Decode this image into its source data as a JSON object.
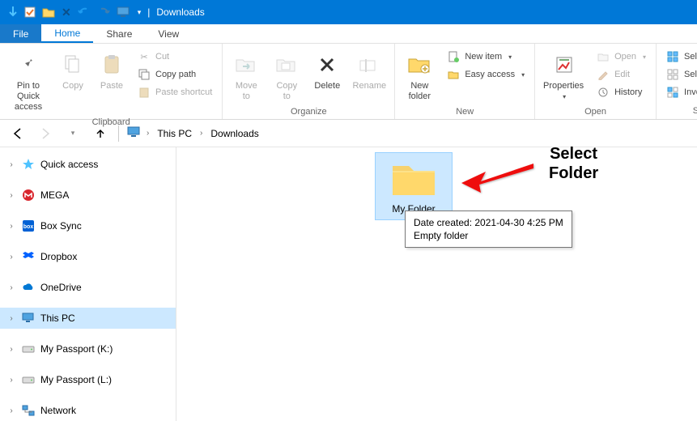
{
  "window": {
    "title": "Downloads"
  },
  "tabs": {
    "file": "File",
    "home": "Home",
    "share": "Share",
    "view": "View"
  },
  "ribbon": {
    "clipboard": {
      "label": "Clipboard",
      "pin": "Pin to Quick\naccess",
      "copy": "Copy",
      "paste": "Paste",
      "cut": "Cut",
      "copy_path": "Copy path",
      "paste_shortcut": "Paste shortcut"
    },
    "organize": {
      "label": "Organize",
      "move_to": "Move\nto",
      "copy_to": "Copy\nto",
      "delete": "Delete",
      "rename": "Rename"
    },
    "new": {
      "label": "New",
      "new_folder": "New\nfolder",
      "new_item": "New item",
      "easy_access": "Easy access"
    },
    "open": {
      "label": "Open",
      "properties": "Properties",
      "open": "Open",
      "edit": "Edit",
      "history": "History"
    },
    "select": {
      "label": "Select",
      "select_all": "Select all",
      "select_none": "Select none",
      "invert": "Invert selection"
    }
  },
  "breadcrumb": {
    "seg1": "This PC",
    "seg2": "Downloads"
  },
  "navpane": {
    "quick_access": "Quick access",
    "mega": "MEGA",
    "box": "Box Sync",
    "dropbox": "Dropbox",
    "onedrive": "OneDrive",
    "this_pc": "This PC",
    "passport_k": "My Passport (K:)",
    "passport_l": "My Passport (L:)",
    "network": "Network"
  },
  "content": {
    "folder_name": "My Folder",
    "tooltip_line1": "Date created: 2021-04-30 4:25 PM",
    "tooltip_line2": "Empty folder"
  },
  "annotation": {
    "line1": "Select",
    "line2": "Folder"
  }
}
